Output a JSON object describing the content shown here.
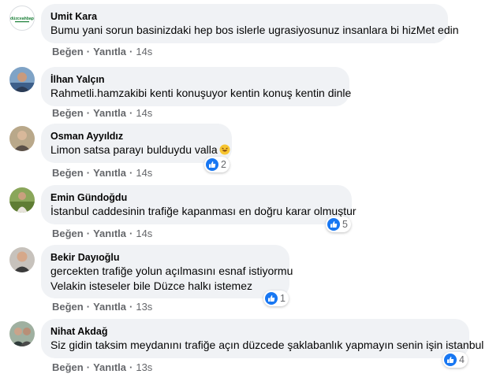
{
  "actions": {
    "like_label": "Beğen",
    "reply_label": "Yanıtla",
    "separator": "·"
  },
  "comments": [
    {
      "author": "Umit Kara",
      "avatar": "duzce-ahbap-logo",
      "avatar_logo_text": "düzceahbap",
      "lines": [
        "Bumu yani sorun basinizdaki hep bos islerle ugrasiyosunuz insanlara bi hizMet edin"
      ],
      "time": "14s",
      "reactions": null
    },
    {
      "author": "İlhan Yalçın",
      "avatar": "profile-photo",
      "lines": [
        "Rahmetli.hamzakibi kenti konuşuyor kentin konuş kentin dinle"
      ],
      "time": "14s",
      "reactions": null
    },
    {
      "author": "Osman Ayyıldız",
      "avatar": "profile-photo",
      "lines": [
        "Limon satsa parayı bulduydu valla"
      ],
      "emoji": "laughing-emoji",
      "time": "14s",
      "reactions": "2"
    },
    {
      "author": "Emin Gündoğdu",
      "avatar": "profile-photo",
      "lines": [
        "İstanbul caddesinin trafiğe kapanması en doğru karar olmuştur"
      ],
      "time": "14s",
      "reactions": "5"
    },
    {
      "author": "Bekir Dayıoğlu",
      "avatar": "profile-photo",
      "lines": [
        "gercekten trafiğe yolun açılmasını esnaf istiyormu",
        "Velakin isteseler bile Düzce halkı istemez"
      ],
      "time": "13s",
      "reactions": "1"
    },
    {
      "author": "Nihat Akdağ",
      "avatar": "profile-photo",
      "lines": [
        "Siz gidin taksim meydanını trafiğe açın düzcede şaklabanlık yapmayın senin işin istanbul"
      ],
      "time": "13s",
      "reactions": "4"
    }
  ],
  "colors": {
    "bubble": "#f0f2f5",
    "secondary_text": "#65676b",
    "like_blue": "#1877f2"
  }
}
